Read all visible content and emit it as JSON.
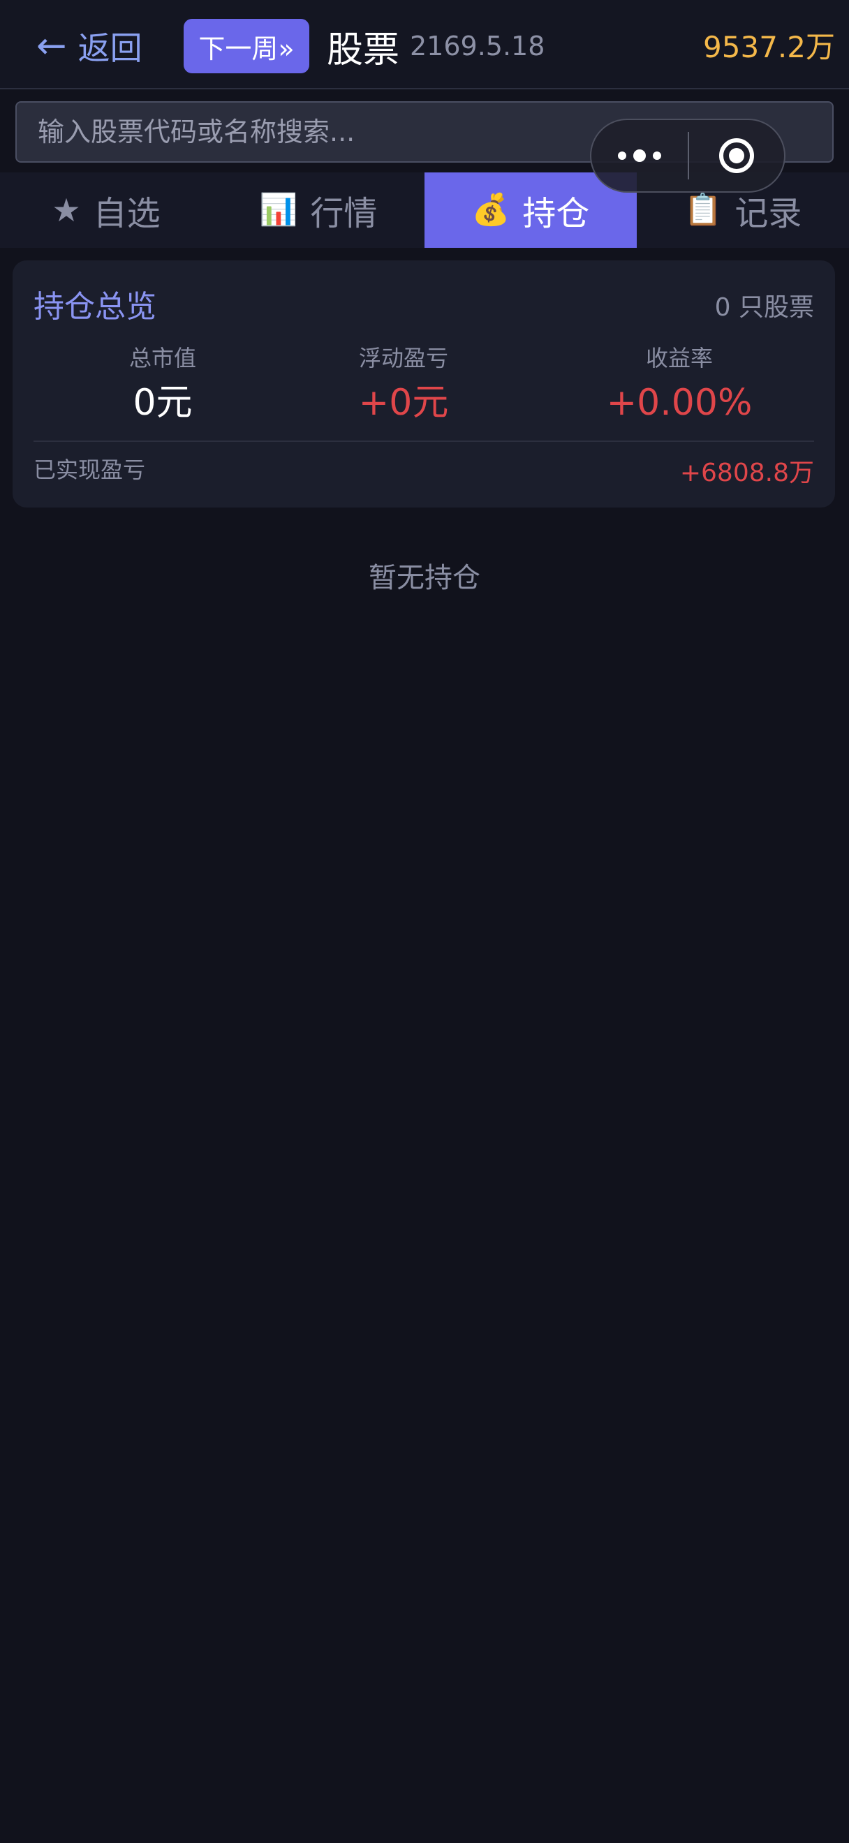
{
  "header": {
    "back_arrow": "←",
    "back_label": "返回",
    "next_week_label": "下一周»",
    "title": "股票",
    "date": "2169.5.18",
    "balance": "9537.2万"
  },
  "search": {
    "placeholder": "输入股票代码或名称搜索..."
  },
  "capsule": {
    "more_icon": "more-dots-icon",
    "close_icon": "target-close-icon"
  },
  "tabs": [
    {
      "icon": "★",
      "icon_name": "star-icon",
      "label": "自选",
      "active": false
    },
    {
      "icon": "📊",
      "icon_name": "bar-chart-icon",
      "label": "行情",
      "active": false
    },
    {
      "icon": "💰",
      "icon_name": "money-bag-icon",
      "label": "持仓",
      "active": true
    },
    {
      "icon": "📋",
      "icon_name": "clipboard-icon",
      "label": "记录",
      "active": false
    }
  ],
  "summary": {
    "title": "持仓总览",
    "stock_count": "0 只股票",
    "metrics": [
      {
        "label": "总市值",
        "value": "0元"
      },
      {
        "label": "浮动盈亏",
        "value": "+0元"
      },
      {
        "label": "收益率",
        "value": "+0.00%"
      }
    ],
    "realized_label": "已实现盈亏",
    "realized_value": "+6808.8万"
  },
  "empty_text": "暂无持仓",
  "colors": {
    "accent": "#6a67ea",
    "background": "#11121c",
    "card": "#1b1e2c",
    "positive_red": "#e0464a",
    "balance_gold": "#f4b84a",
    "link_blue": "#8aa0f0"
  }
}
